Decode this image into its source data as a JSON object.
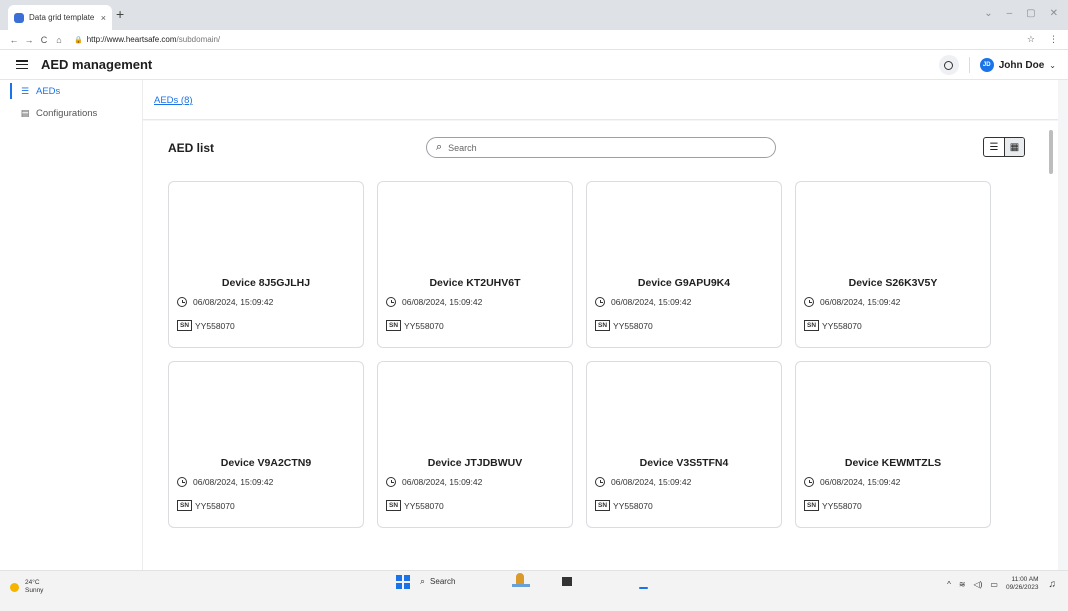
{
  "browser": {
    "tab_title": "Data grid template",
    "tab_close": "×",
    "new_tab": "+",
    "url_host": "http://www.heartsafe.com",
    "url_path": "/subdomain/",
    "window_controls": [
      "⌄",
      "–",
      "▢",
      "✕"
    ],
    "nav_icons": [
      "←",
      "→",
      "C",
      "⌂"
    ],
    "toolbar_icons": [
      "☆",
      "⋮"
    ]
  },
  "header": {
    "title": "AED management",
    "user_initials": "JD",
    "user_name": "John Doe"
  },
  "sidebar": {
    "items": [
      {
        "label": "AEDs",
        "icon": "list-icon",
        "glyph": "☰",
        "active": true
      },
      {
        "label": "Configurations",
        "icon": "document-icon",
        "glyph": "▤",
        "active": false
      }
    ]
  },
  "breadcrumb": "AEDs (8)",
  "list": {
    "title": "AED list",
    "search_placeholder": "Search",
    "view_list_glyph": "☰",
    "view_grid_glyph": "▦"
  },
  "devices": [
    {
      "name": "Device 8J5GJLHJ",
      "timestamp": "06/08/2024, 15:09:42",
      "sn_label": "SN",
      "serial": "YY558070"
    },
    {
      "name": "Device KT2UHV6T",
      "timestamp": "06/08/2024, 15:09:42",
      "sn_label": "SN",
      "serial": "YY558070"
    },
    {
      "name": "Device G9APU9K4",
      "timestamp": "06/08/2024, 15:09:42",
      "sn_label": "SN",
      "serial": "YY558070"
    },
    {
      "name": "Device S26K3V5Y",
      "timestamp": "06/08/2024, 15:09:42",
      "sn_label": "SN",
      "serial": "YY558070"
    },
    {
      "name": "Device V9A2CTN9",
      "timestamp": "06/08/2024, 15:09:42",
      "sn_label": "SN",
      "serial": "YY558070"
    },
    {
      "name": "Device JTJDBWUV",
      "timestamp": "06/08/2024, 15:09:42",
      "sn_label": "SN",
      "serial": "YY558070"
    },
    {
      "name": "Device V3S5TFN4",
      "timestamp": "06/08/2024, 15:09:42",
      "sn_label": "SN",
      "serial": "YY558070"
    },
    {
      "name": "Device KEWMTZLS",
      "timestamp": "06/08/2024, 15:09:42",
      "sn_label": "SN",
      "serial": "YY558070"
    }
  ],
  "taskbar": {
    "temperature": "24°C",
    "condition": "Sunny",
    "search_label": "Search",
    "tray_glyphs": [
      "^",
      "≋",
      "◁)",
      "▭"
    ],
    "time": "11:00 AM",
    "date": "09/26/2023",
    "bell_glyph": "🔔"
  },
  "colors": {
    "accent": "#1a73e8",
    "page_bg": "#f4f5f7"
  }
}
